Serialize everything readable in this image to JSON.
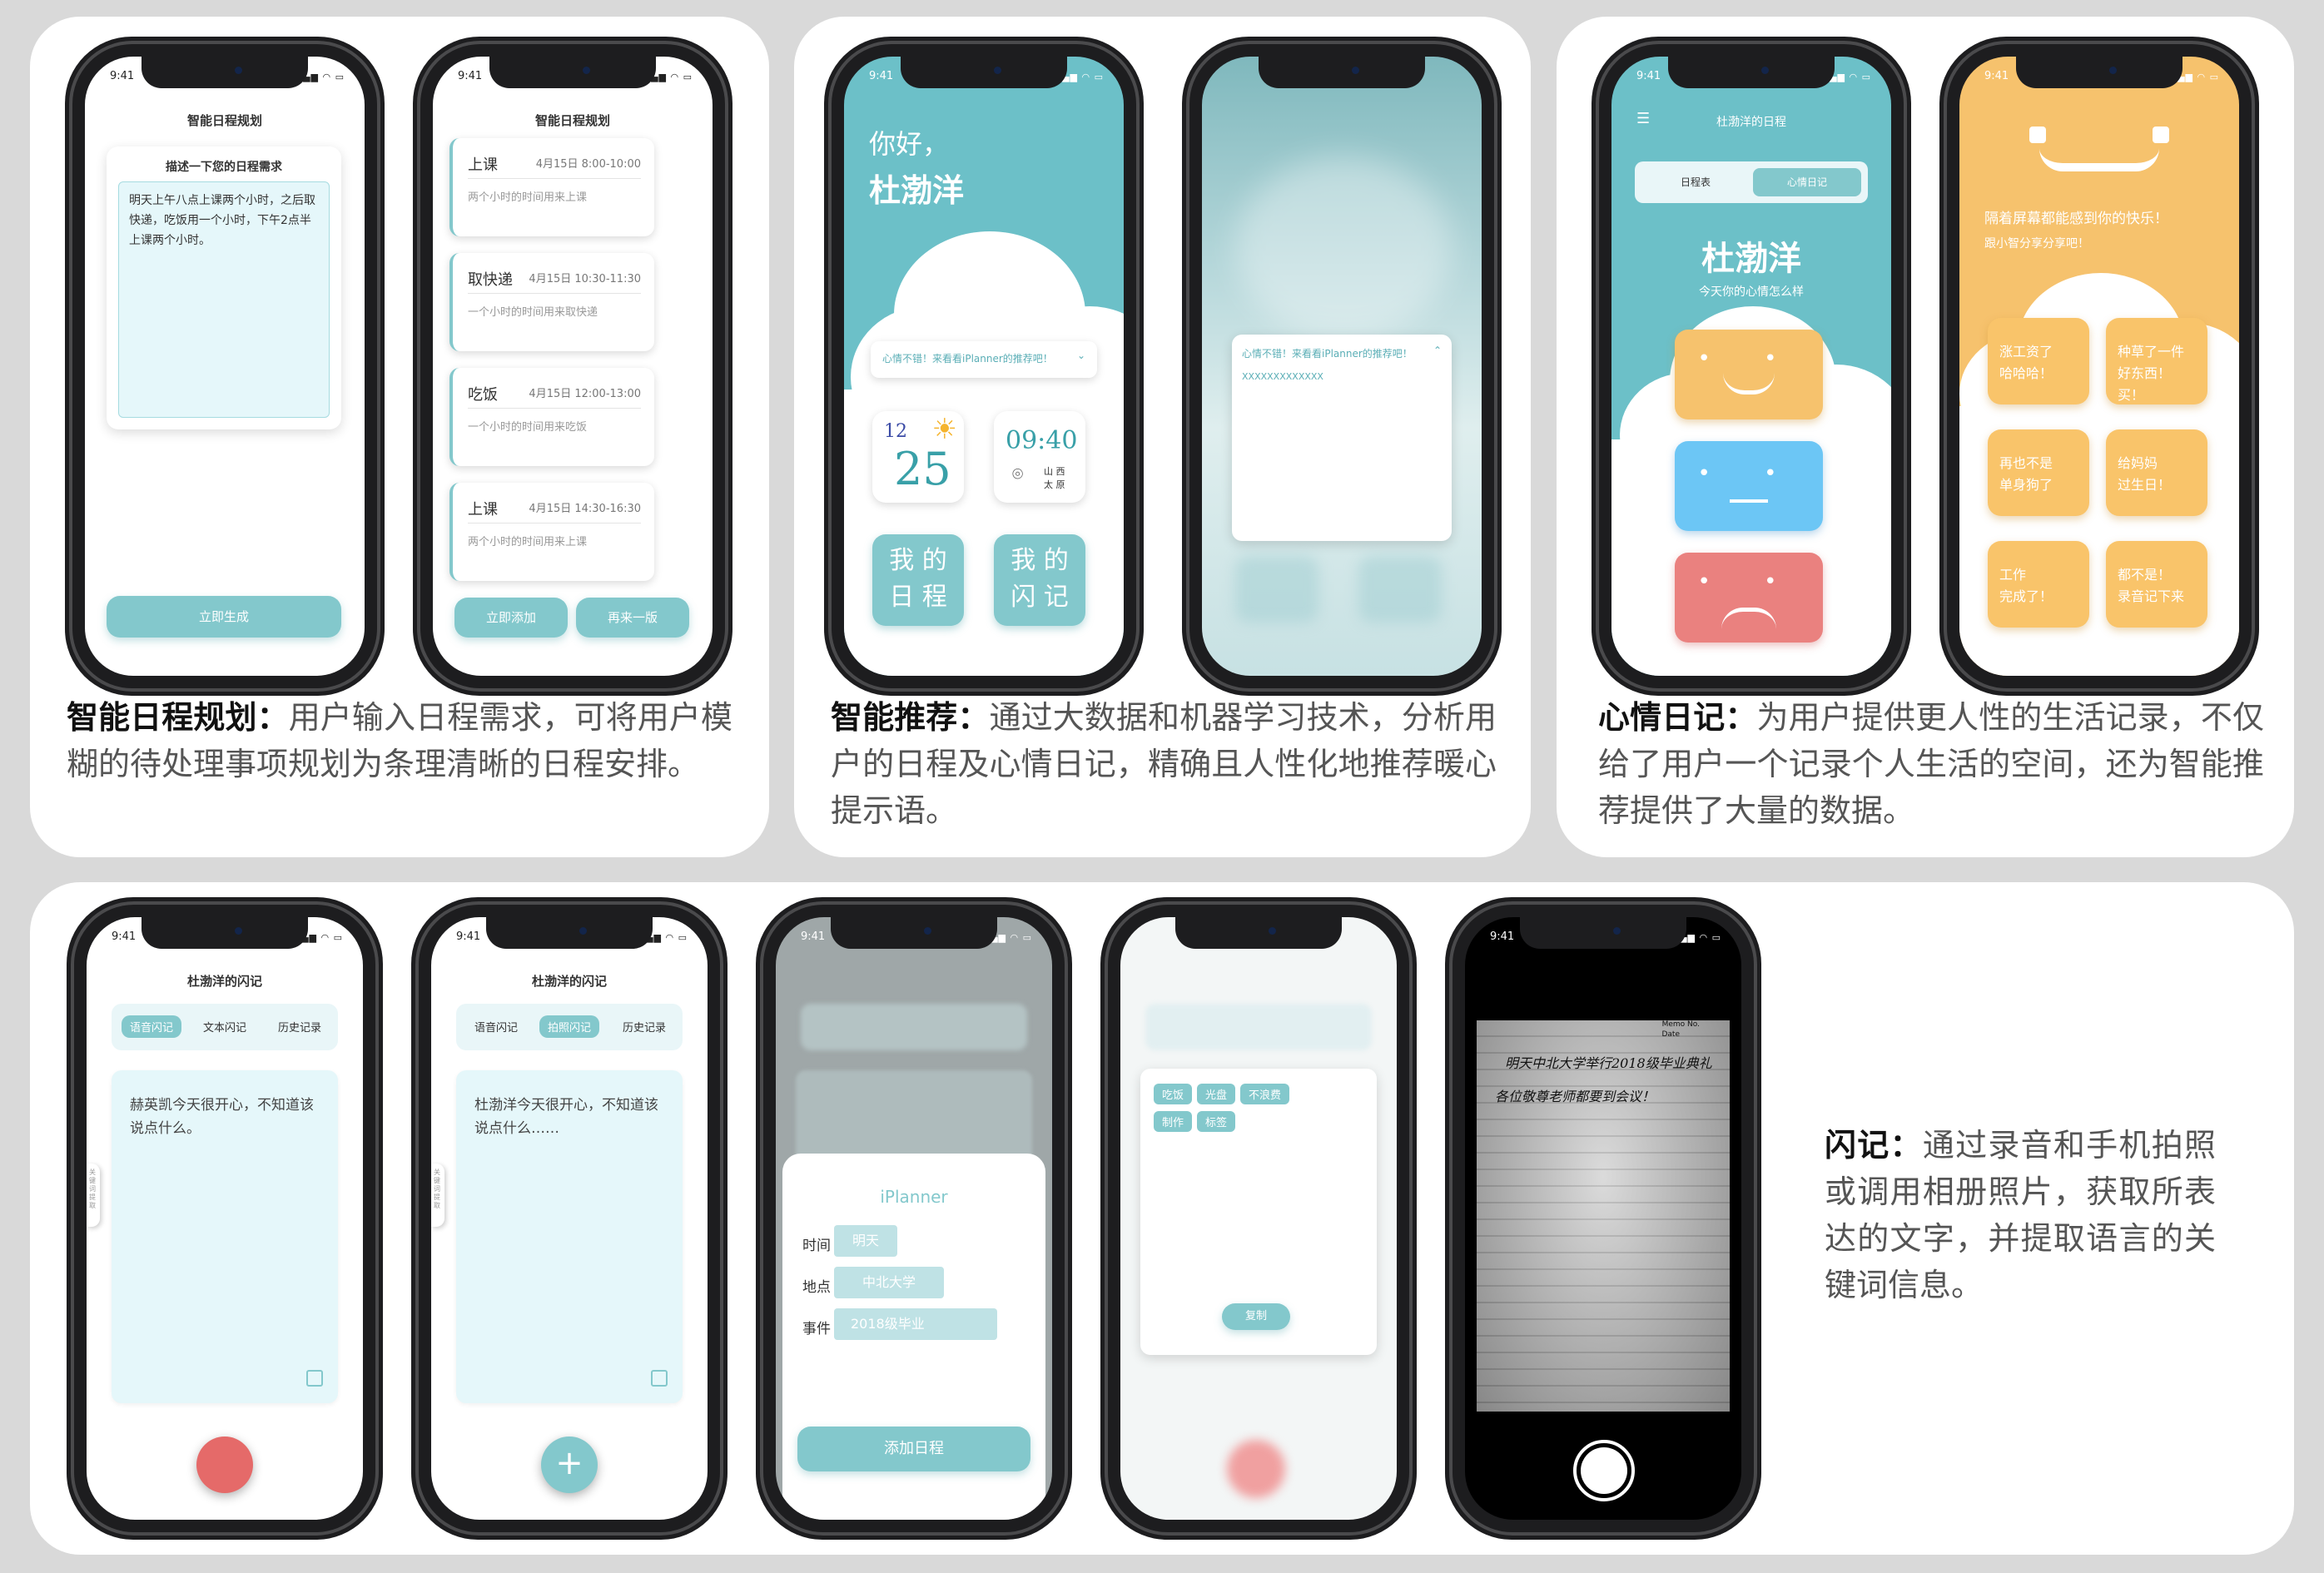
{
  "status_time": "9:41",
  "status_icons": "▂▄▆ ◠ ▭",
  "sec1": {
    "caption_bold": "智能日程规划：",
    "caption": "用户输入日程需求，可将用户模糊的待处理事项规划为条理清晰的日程安排。",
    "p1": {
      "title": "智能日程规划",
      "prompt": "描述一下您的日程需求",
      "input_text": "明天上午八点上课两个小时，之后取快递，吃饭用一个小时，下午2点半上课两个小时。",
      "generate_button": "立即生成"
    },
    "p2": {
      "title": "智能日程规划",
      "events": [
        {
          "name": "上课",
          "time": "4月15日 8:00-10:00",
          "desc": "两个小时的时间用来上课"
        },
        {
          "name": "取快递",
          "time": "4月15日 10:30-11:30",
          "desc": "一个小时的时间用来取快递"
        },
        {
          "name": "吃饭",
          "time": "4月15日 12:00-13:00",
          "desc": "一个小时的时间用来吃饭"
        },
        {
          "name": "上课",
          "time": "4月15日 14:30-16:30",
          "desc": "两个小时的时间用来上课"
        }
      ],
      "add_button": "立即添加",
      "redo_button": "再来一版"
    }
  },
  "sec2": {
    "caption_bold": "智能推荐：",
    "caption": "通过大数据和机器学习技术，分析用户的日程及心情日记，精确且人性化地推荐暖心提示语。",
    "p1": {
      "greeting": "你好，",
      "name": "杜渤洋",
      "recommend": "心情不错！来看看iPlanner的推荐吧！",
      "cal_month": "12",
      "cal_day": "25",
      "clock": "09:40",
      "loc1": "山 西",
      "loc2": "太 原",
      "btn_schedule": "我 的\n日 程",
      "btn_notes": "我 的\n闪 记"
    },
    "p2": {
      "recommend": "心情不错！来看看iPlanner的推荐吧！",
      "content": "XXXXXXXXXXXXX"
    }
  },
  "sec3": {
    "caption_bold": "心情日记：",
    "caption": "为用户提供更人性的生活记录，不仅给了用户一个记录个人生活的空间，还为智能推荐提供了大量的数据。",
    "p1": {
      "title": "杜渤洋的日程",
      "tab1": "日程表",
      "tab2": "心情日记",
      "name": "杜渤洋",
      "question": "今天你的心情怎么样",
      "face_colors": [
        "#f6c26d",
        "#6cc6f5",
        "#ea817f"
      ]
    },
    "p2": {
      "line1": "隔着屏幕都能感到你的快乐！",
      "line2": "跟小智分享分享吧！",
      "tiles": [
        "涨工资了\n哈哈哈！",
        "种草了一件\n好东西！买！",
        "再也不是\n单身狗了",
        "给妈妈\n过生日！",
        "工作\n完成了！",
        "都不是！\n录音记下来"
      ]
    }
  },
  "sec4": {
    "caption_bold": "闪记：",
    "caption": "通过录音和手机拍照或调用相册照片，获取所表达的文字，并提取语言的关键词信息。",
    "p1": {
      "title": "杜渤洋的闪记",
      "tabs": [
        "语音闪记",
        "文本闪记",
        "历史记录"
      ],
      "text": "赫英凯今天很开心，不知道该说点什么。",
      "side": "关键词提取"
    },
    "p2": {
      "title": "杜渤洋的闪记",
      "tabs": [
        "语音闪记",
        "拍照闪记",
        "历史记录"
      ],
      "text": "杜渤洋今天很开心，不知道该说点什么……",
      "side": "关键词提取",
      "add": "+"
    },
    "p3": {
      "app": "iPlanner",
      "time_label": "时间",
      "time_val": "明天",
      "place_label": "地点",
      "place_val": "中北大学",
      "event_label": "事件",
      "event_val": "2018级毕业",
      "add_button": "添加日程"
    },
    "p4": {
      "tags": [
        "吃饭",
        "光盘",
        "不浪费",
        "制作",
        "标签"
      ],
      "copy_button": "复制"
    },
    "p5": {
      "memo_no": "Memo No.",
      "memo_date": "Date",
      "hw1": "明天中北大学举行2018级毕业典礼",
      "hw2": "各位敬尊老师都要到会议！"
    }
  }
}
